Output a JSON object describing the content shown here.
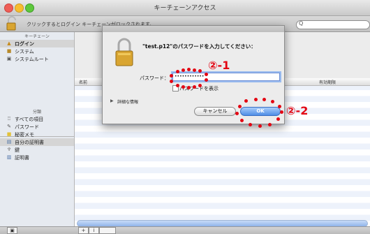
{
  "window": {
    "title": "キーチェーンアクセス"
  },
  "toolbar": {
    "lock_hint": "クリックするとログイン キーチェーンがロックされます。",
    "search_glyph": "Q"
  },
  "sidebar": {
    "keychain_header": "キーチェーン",
    "keychains": [
      {
        "label": "ログイン",
        "icon": "lock-open-icon"
      },
      {
        "label": "システム",
        "icon": "lock-icon"
      },
      {
        "label": "システムルート",
        "icon": "folder-icon"
      }
    ],
    "category_header": "分類",
    "categories": [
      {
        "label": "すべての項目",
        "icon": "all-items-icon"
      },
      {
        "label": "パスワード",
        "icon": "password-icon"
      },
      {
        "label": "秘密メモ",
        "icon": "note-icon"
      },
      {
        "label": "自分の証明書",
        "icon": "my-certificate-icon"
      },
      {
        "label": "鍵",
        "icon": "key-icon"
      },
      {
        "label": "証明書",
        "icon": "certificate-icon"
      }
    ]
  },
  "list": {
    "col_name": "名前",
    "col_expires": "有効期限"
  },
  "bottombar": {
    "add": "+",
    "info": "i"
  },
  "dialog": {
    "title": "\"test.p12\"のパスワードを入力してください：",
    "password_label": "パスワード：",
    "password_value": "••••••••••••",
    "show_password_label": "パスワードを表示",
    "details_label": "詳細な情報",
    "cancel_label": "キャンセル",
    "ok_label": "OK"
  },
  "annotations": {
    "step1": "②-1",
    "step2": "②-2",
    "color": "#e30613"
  }
}
